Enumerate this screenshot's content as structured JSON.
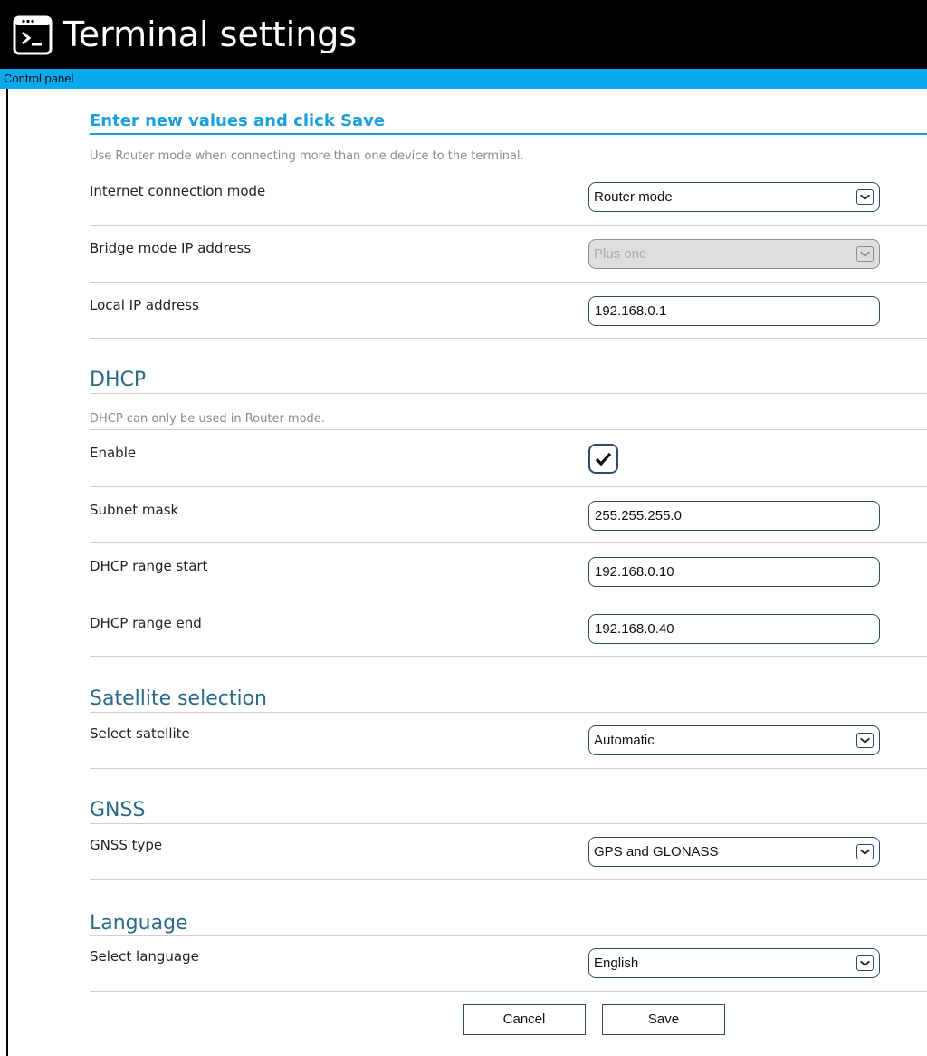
{
  "window": {
    "title": "Terminal settings"
  },
  "breadcrumb": "Control panel",
  "form": {
    "heading": "Enter new values and click Save",
    "note": "Use Router mode when connecting more than one device to the terminal.",
    "internet_mode": {
      "label": "Internet connection mode",
      "value": "Router mode"
    },
    "bridge_ip": {
      "label": "Bridge mode IP address",
      "value": "Plus one",
      "disabled": true
    },
    "local_ip": {
      "label": "Local IP address",
      "value": "192.168.0.1"
    }
  },
  "dhcp": {
    "heading": "DHCP",
    "note": "DHCP can only be used in Router mode.",
    "enable": {
      "label": "Enable",
      "checked": true
    },
    "subnet": {
      "label": "Subnet mask",
      "value": "255.255.255.0"
    },
    "range_start": {
      "label": "DHCP range start",
      "value": "192.168.0.10"
    },
    "range_end": {
      "label": "DHCP range end",
      "value": "192.168.0.40"
    }
  },
  "satellite": {
    "heading": "Satellite selection",
    "select": {
      "label": "Select satellite",
      "value": "Automatic"
    }
  },
  "gnss": {
    "heading": "GNSS",
    "type": {
      "label": "GNSS type",
      "value": "GPS and GLONASS"
    }
  },
  "language": {
    "heading": "Language",
    "select": {
      "label": "Select language",
      "value": "English"
    }
  },
  "buttons": {
    "cancel": "Cancel",
    "save": "Save"
  },
  "colors": {
    "titlebar": "#000000",
    "crumbbar": "#0aa9ec",
    "accent": "#1ba0dd",
    "heading": "#2b6a87"
  },
  "icons": {
    "title": "terminal-icon",
    "dropdown": "chevron-down-icon",
    "check": "checkmark-icon"
  }
}
